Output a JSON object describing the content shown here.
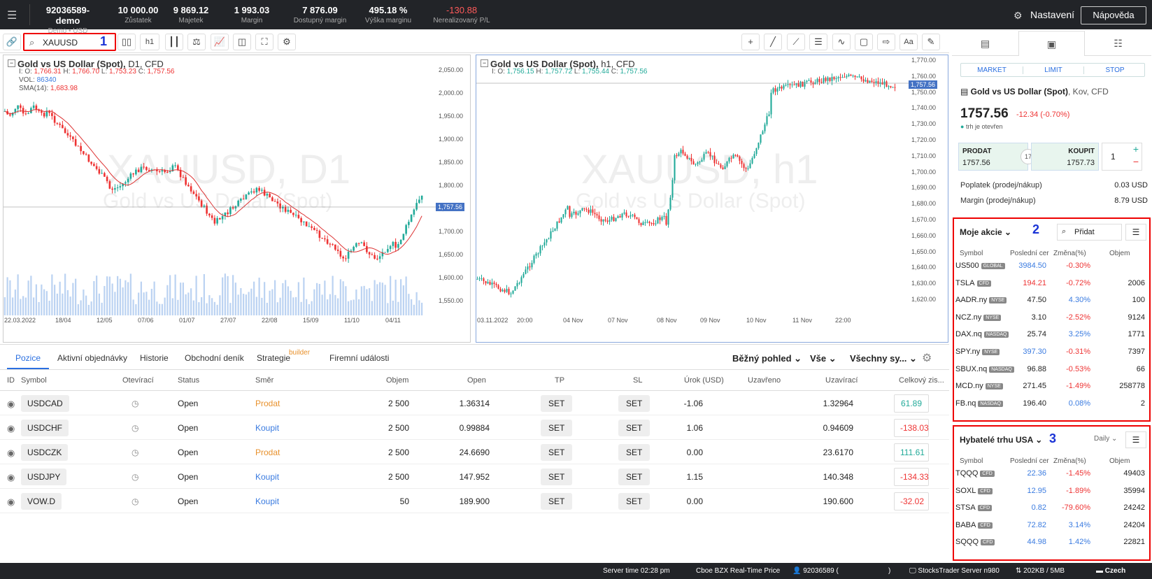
{
  "account": {
    "id": "92036589-demo",
    "sub": "Demo • USD"
  },
  "stats": [
    {
      "value": "10 000.00",
      "label": "Zůstatek"
    },
    {
      "value": "9 869.12",
      "label": "Majetek"
    },
    {
      "value": "1 993.03",
      "label": "Margin"
    },
    {
      "value": "7 876.09",
      "label": "Dostupný margin"
    },
    {
      "value": "495.18 %",
      "label": "Výška marginu"
    },
    {
      "value": "-130.88",
      "label": "Nerealizovaný P/L"
    }
  ],
  "header": {
    "settings": "Nastavení",
    "help": "Nápověda"
  },
  "toolbar": {
    "search_value": "XAUUSD",
    "timeframe": "h1",
    "font_btn": "Aa"
  },
  "annotations": {
    "n1": "1",
    "n2": "2",
    "n3": "3"
  },
  "chart1": {
    "title": "Gold vs US Dollar (Spot),",
    "tf": "D1, CFD",
    "o": "I: O: ",
    "ov": "1,766.31",
    "h": " H: ",
    "hv": "1,766.70",
    "l": " L: ",
    "lv": "1,753.23",
    "c": " C: ",
    "cv": "1,757.56",
    "vol": "VOL: ",
    "volv": "86340",
    "sma": "SMA(14): ",
    "smav": "1,683.98",
    "wm": "XAUUSD, D1",
    "wm2": "Gold vs US Dollar (Spot)",
    "price": "1,757.56",
    "yticks": [
      "2,050.00",
      "2,000.00",
      "1,950.00",
      "1,900.00",
      "1,850.00",
      "1,800.00",
      "1,750.00",
      "1,700.00",
      "1,650.00",
      "1,600.00",
      "1,550.00"
    ],
    "xticks": [
      "22.03.2022",
      "18/04",
      "12/05",
      "07/06",
      "01/07",
      "27/07",
      "22/08",
      "15/09",
      "11/10",
      "04/11"
    ]
  },
  "chart2": {
    "title": "Gold vs US Dollar (Spot),",
    "tf": "h1, CFD",
    "o": "I: O: ",
    "ov": "1,756.15",
    "h": " H: ",
    "hv": "1,757.72",
    "l": " L: ",
    "lv": "1,755.44",
    "c": " C: ",
    "cv": "1,757.56",
    "wm": "XAUUSD, h1",
    "wm2": "Gold vs US Dollar (Spot)",
    "price": "1,757.56",
    "yticks": [
      "1,770.00",
      "1,760.00",
      "1,750.00",
      "1,740.00",
      "1,730.00",
      "1,720.00",
      "1,710.00",
      "1,700.00",
      "1,690.00",
      "1,680.00",
      "1,670.00",
      "1,660.00",
      "1,650.00",
      "1,640.00",
      "1,630.00",
      "1,620.00"
    ],
    "xticks": [
      "03.11.2022",
      "20:00",
      "04 Nov",
      "07 Nov",
      "08 Nov",
      "09 Nov",
      "10 Nov",
      "11 Nov",
      "22:00"
    ]
  },
  "tabs": [
    "Pozice",
    "Aktivní objednávky",
    "Historie",
    "Obchodní deník",
    "Strategie",
    "Firemní události"
  ],
  "builder": "builder",
  "filters": [
    "Běžný pohled",
    "Vše",
    "Všechny sy..."
  ],
  "columns": [
    "ID",
    "Symbol",
    "Otevírací",
    "Status",
    "Směr",
    "Objem",
    "Open",
    "TP",
    "SL",
    "Úrok (USD)",
    "Uzavřeno",
    "Uzavírací",
    "Celkový zis..."
  ],
  "positions": [
    {
      "symbol": "USDCAD",
      "status": "Open",
      "side": "Prodat",
      "volume": "2 500",
      "open": "1.36314",
      "tp": "SET",
      "sl": "SET",
      "interest": "-1.06",
      "close": "1.32964",
      "pnl": "61.89"
    },
    {
      "symbol": "USDCHF",
      "status": "Open",
      "side": "Koupit",
      "volume": "2 500",
      "open": "0.99884",
      "tp": "SET",
      "sl": "SET",
      "interest": "1.06",
      "close": "0.94609",
      "pnl": "-138.03"
    },
    {
      "symbol": "USDCZK",
      "status": "Open",
      "side": "Prodat",
      "volume": "2 500",
      "open": "24.6690",
      "tp": "SET",
      "sl": "SET",
      "interest": "0.00",
      "close": "23.6170",
      "pnl": "111.61"
    },
    {
      "symbol": "USDJPY",
      "status": "Open",
      "side": "Koupit",
      "volume": "2 500",
      "open": "147.952",
      "tp": "SET",
      "sl": "SET",
      "interest": "1.15",
      "close": "140.348",
      "pnl": "-134.33"
    },
    {
      "symbol": "VOW.D",
      "status": "Open",
      "side": "Koupit",
      "volume": "50",
      "open": "189.900",
      "tp": "SET",
      "sl": "SET",
      "interest": "0.00",
      "close": "190.600",
      "pnl": "-32.02"
    }
  ],
  "order": {
    "types": [
      "MARKET",
      "LIMIT",
      "STOP"
    ],
    "instrument": "Gold vs US Dollar (Spot)",
    "instrument_sub": ", Kov, CFD",
    "price": "1757.56",
    "change": "-12.34 (-0.70%)",
    "market_status": "trh je otevřen",
    "sell_label": "PRODAT",
    "sell_price": "1757.56",
    "spread": "17",
    "buy_label": "KOUPIT",
    "buy_price": "1757.73",
    "qty": "1",
    "fee_label": "Poplatek (prodej/nákup)",
    "fee_value": "0.03 USD",
    "margin_label": "Margin (prodej/nákup)",
    "margin_value": "8.79 USD"
  },
  "watchlist": {
    "title": "Moje akcie",
    "search_placeholder": "Přidat",
    "cols": [
      "Symbol",
      "Poslední cer",
      "Změna(%)",
      "Objem"
    ],
    "rows": [
      {
        "s": "US500",
        "b": "GLOBAL",
        "p": "3984.50",
        "c": "-0.30%",
        "v": "",
        "pc": "pos",
        "cc": "neg"
      },
      {
        "s": "TSLA",
        "b": "CFD",
        "p": "194.21",
        "c": "-0.72%",
        "v": "2006",
        "pc": "neg",
        "cc": "neg"
      },
      {
        "s": "AADR.ny",
        "b": "NYSE",
        "p": "47.50",
        "c": "4.30%",
        "v": "100",
        "pc": "",
        "cc": "pos"
      },
      {
        "s": "NCZ.ny",
        "b": "NYSE",
        "p": "3.10",
        "c": "-2.52%",
        "v": "9124",
        "pc": "",
        "cc": "neg"
      },
      {
        "s": "DAX.nq",
        "b": "NASDAQ",
        "p": "25.74",
        "c": "3.25%",
        "v": "1771",
        "pc": "",
        "cc": "pos"
      },
      {
        "s": "SPY.ny",
        "b": "NYSE",
        "p": "397.30",
        "c": "-0.31%",
        "v": "7397",
        "pc": "pos",
        "cc": "neg"
      },
      {
        "s": "SBUX.nq",
        "b": "NASDAQ",
        "p": "96.88",
        "c": "-0.53%",
        "v": "66",
        "pc": "",
        "cc": "neg"
      },
      {
        "s": "MCD.ny",
        "b": "NYSE",
        "p": "271.45",
        "c": "-1.49%",
        "v": "258778",
        "pc": "",
        "cc": "neg"
      },
      {
        "s": "FB.nq",
        "b": "NASDAQ",
        "p": "196.40",
        "c": "0.08%",
        "v": "2",
        "pc": "",
        "cc": "pos"
      }
    ]
  },
  "movers": {
    "title": "Hybatelé trhu USA",
    "period": "Daily",
    "cols": [
      "Symbol",
      "Poslední cer",
      "Změna(%)",
      "Objem"
    ],
    "rows": [
      {
        "s": "TQQQ",
        "b": "CFD",
        "p": "22.36",
        "c": "-1.45%",
        "v": "49403"
      },
      {
        "s": "SOXL",
        "b": "CFD",
        "p": "12.95",
        "c": "-1.89%",
        "v": "35994"
      },
      {
        "s": "STSA",
        "b": "CFD",
        "p": "0.82",
        "c": "-79.60%",
        "v": "24242"
      },
      {
        "s": "BABA",
        "b": "CFD",
        "p": "72.82",
        "c": "3.14%",
        "v": "24204"
      },
      {
        "s": "SQQQ",
        "b": "CFD",
        "p": "44.98",
        "c": "1.42%",
        "v": "22821"
      }
    ]
  },
  "status": {
    "server_time": "Server time 02:28 pm",
    "feed": "Cboe BZX Real-Time Price",
    "user": "92036589 (",
    "user_end": ")",
    "server": "StocksTrader Server n980",
    "traffic": "202KB / 5MB",
    "lang": "Czech"
  },
  "colors": {
    "accent": "#2a6fe0",
    "negative": "#e33",
    "positive": "#2a9",
    "dark": "#222428"
  }
}
